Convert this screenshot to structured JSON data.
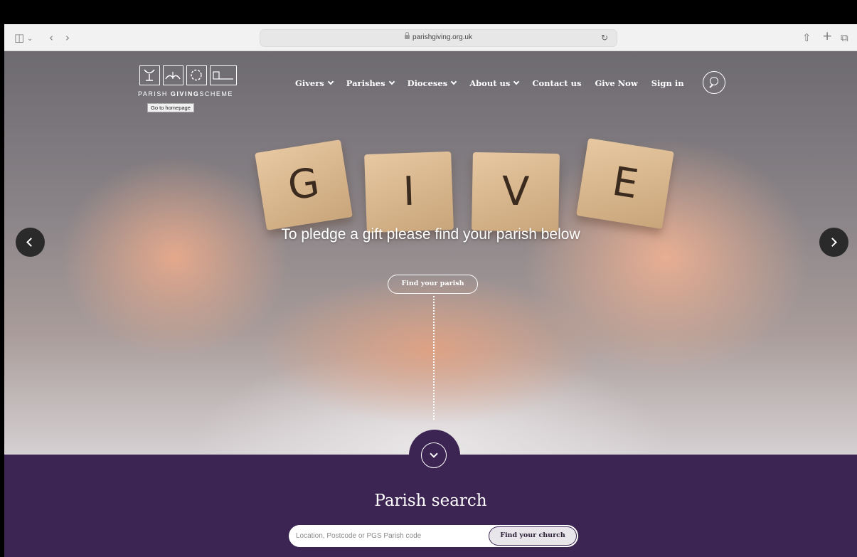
{
  "browser": {
    "url": "parishgiving.org.uk"
  },
  "logo": {
    "text_a": "PARISH ",
    "text_b": "GIVING",
    "text_c": "SCHEME",
    "tooltip": "Go to homepage"
  },
  "nav": {
    "items": [
      {
        "label": "Givers",
        "dropdown": true
      },
      {
        "label": "Parishes",
        "dropdown": true
      },
      {
        "label": "Dioceses",
        "dropdown": true
      },
      {
        "label": "About us",
        "dropdown": true
      },
      {
        "label": "Contact us",
        "dropdown": false
      },
      {
        "label": "Give Now",
        "dropdown": false
      },
      {
        "label": "Sign in",
        "dropdown": false
      }
    ]
  },
  "hero": {
    "tile_letters": [
      "G",
      "I",
      "V",
      "E"
    ],
    "headline": "To pledge a gift please find your parish below",
    "button": "Find your parish"
  },
  "parish_search": {
    "title": "Parish search",
    "placeholder": "Location, Postcode or PGS Parish code",
    "button": "Find your church"
  },
  "colors": {
    "brand_purple": "#3c2552"
  }
}
